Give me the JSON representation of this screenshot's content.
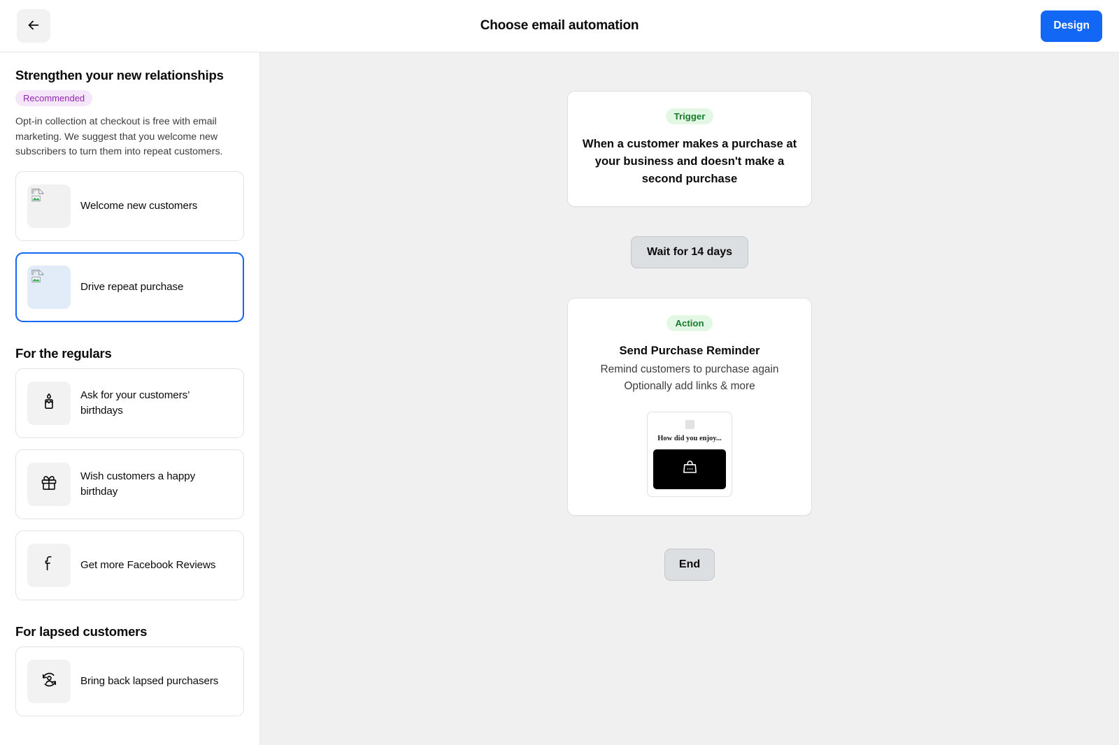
{
  "header": {
    "back_icon": "arrow-left-icon",
    "title": "Choose email automation",
    "design_label": "Design"
  },
  "sidebar": {
    "sections": [
      {
        "title": "Strengthen your new relationships",
        "badge": "Recommended",
        "description": "Opt-in collection at checkout is free with email marketing. We suggest that you welcome new subscribers to turn them into repeat customers.",
        "cards": [
          {
            "label": "Welcome new customers",
            "icon": "broken-image-icon",
            "selected": false
          },
          {
            "label": "Drive repeat purchase",
            "icon": "broken-image-icon",
            "selected": true
          }
        ]
      },
      {
        "title": "For the regulars",
        "cards": [
          {
            "label": "Ask for your customers’ birthdays",
            "icon": "candle-icon",
            "selected": false
          },
          {
            "label": "Wish customers a happy birthday",
            "icon": "gift-icon",
            "selected": false
          },
          {
            "label": "Get more Facebook Reviews",
            "icon": "facebook-icon",
            "selected": false
          }
        ]
      },
      {
        "title": "For lapsed customers",
        "cards": [
          {
            "label": "Bring back lapsed purchasers",
            "icon": "user-return-icon",
            "selected": false
          }
        ]
      }
    ]
  },
  "canvas": {
    "trigger": {
      "pill": "Trigger",
      "headline": "When a customer makes a purchase at your business and doesn't make a second purchase"
    },
    "wait": {
      "label": "Wait for 14 days"
    },
    "action": {
      "pill": "Action",
      "title": "Send Purchase Reminder",
      "line1": "Remind customers to purchase again",
      "line2": "Optionally add links & more",
      "preview": {
        "heading": "How did you enjoy...",
        "hero_icon": "shopping-bag-icon"
      }
    },
    "end": {
      "label": "End"
    }
  },
  "colors": {
    "accent": "#1267f4",
    "canvas_bg": "#f0f0f0",
    "badge_recommended_bg": "#f6e6fa",
    "badge_recommended_fg": "#9327b0",
    "pill_green_bg": "#e3f8e4",
    "pill_green_fg": "#1a7a2e",
    "node_chip_bg": "#dcdfe1"
  }
}
